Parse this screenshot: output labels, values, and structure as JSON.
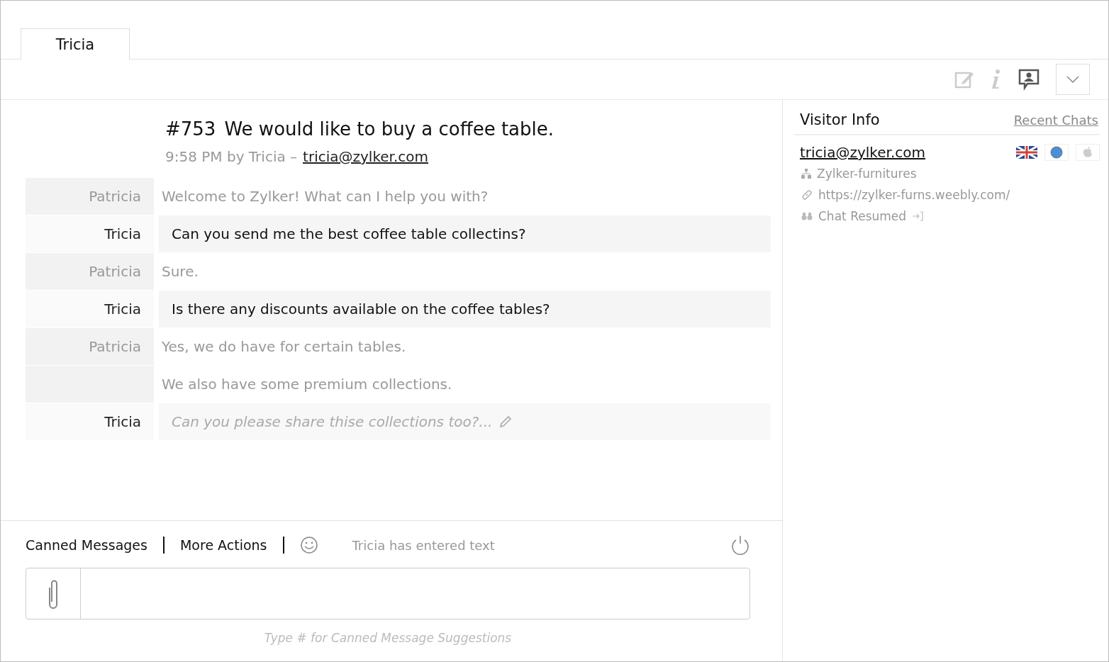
{
  "tabs": [
    {
      "label": "Tricia",
      "selected": true
    }
  ],
  "chat": {
    "number": "#753",
    "subject": "We would like to buy a coffee table.",
    "meta": "9:58 PM by Tricia –",
    "email": "tricia@zylker.com",
    "messages": [
      {
        "kind": "agent",
        "sender": "Patricia",
        "text": "Welcome to Zylker! What can I help you with?"
      },
      {
        "kind": "visitor",
        "sender": "Tricia",
        "text": "Can you send me the best coffee table collectins?"
      },
      {
        "kind": "agent",
        "sender": "Patricia",
        "text": "Sure."
      },
      {
        "kind": "visitor",
        "sender": "Tricia",
        "text": "Is there any discounts available on the coffee tables?"
      },
      {
        "kind": "agent",
        "sender": "Patricia",
        "text": "Yes, we do have for certain tables."
      },
      {
        "kind": "agent",
        "text": "We also have some premium collections."
      },
      {
        "kind": "typing",
        "sender": "Tricia",
        "text": "Can you please share thise collections too?..."
      }
    ]
  },
  "composer": {
    "actions": [
      "Canned Messages",
      "More Actions"
    ],
    "typing_status": "Tricia has entered text",
    "hint": "Type # for Canned Message Suggestions"
  },
  "visitor_info": {
    "title": "Visitor Info",
    "link": "Recent Chats",
    "email": "tricia@zylker.com",
    "company": "Zylker-furnitures",
    "url": "https://zylker-furns.weebly.com/",
    "status": "Chat Resumed"
  }
}
